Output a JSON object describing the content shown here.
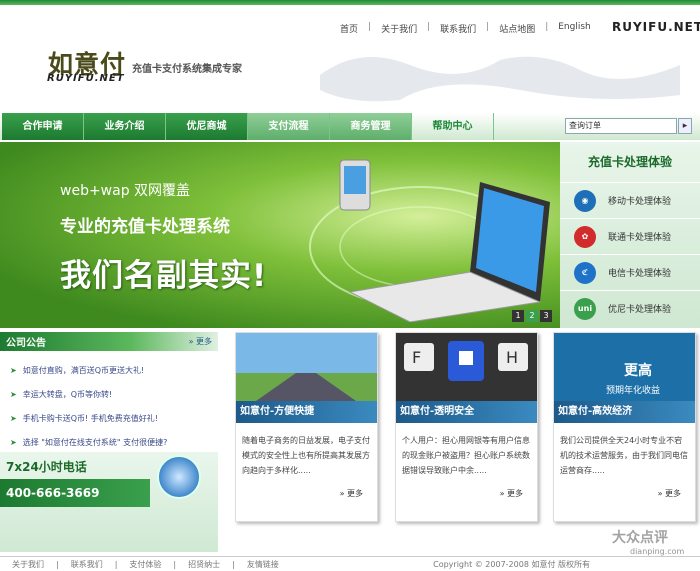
{
  "header": {
    "logo_cn": "如意付",
    "logo_en": "RUYIFU.NET",
    "slogan": "充值卡支付系统集成专家",
    "top_links": [
      "首页",
      "关于我们",
      "联系我们",
      "站点地图",
      "English"
    ],
    "brand_right": "RUYIFU.NET"
  },
  "nav": {
    "items": [
      "合作申请",
      "业务介绍",
      "优尼商城",
      "支付流程",
      "商务管理",
      "帮助中心"
    ],
    "search_placeholder": "查询订单"
  },
  "banner": {
    "line1": "web+wap  双网覆盖",
    "line2": "专业的充值卡处理系统",
    "line3": "我们名副其实!",
    "pages": [
      "1",
      "2",
      "3"
    ],
    "active_page": 2
  },
  "side": {
    "title": "充值卡处理体验",
    "items": [
      {
        "label": "移动卡处理体验",
        "icon": "china-mobile-icon",
        "color": "#1e6fb8"
      },
      {
        "label": "联通卡处理体验",
        "icon": "china-unicom-icon",
        "color": "#d12b2b"
      },
      {
        "label": "电信卡处理体验",
        "icon": "china-telecom-icon",
        "color": "#1e73c8"
      },
      {
        "label": "优尼卡处理体验",
        "icon": "uni-card-icon",
        "color": "#3aa04d"
      }
    ]
  },
  "notice": {
    "title": "公司公告",
    "more": "更多",
    "items": [
      "如意付直购，满百送Q币更送大礼!",
      "幸运大转盘，Q币等你转!",
      "手机卡购卡送Q币! 手机免费充值好礼!",
      "选择 \"如意付在线支付系统\" 支付很便捷?"
    ]
  },
  "hotline": {
    "label": "7x24小时电话",
    "phone": "400-666-3669"
  },
  "cards": [
    {
      "title": "如意付-方便快捷",
      "text": "随着电子商务的日益发展，电子支付模式的安全性上也有所提高其发展方向趋向于多样化.....",
      "more": "更多"
    },
    {
      "title": "如意付-透明安全",
      "text": "个人用户：担心用网银等有用户信息的现金账户被盗用？担心账户系统数据错误导致账户中余.....",
      "more": "更多"
    },
    {
      "title": "如意付-高效经济",
      "text": "我们公司提供全天24小时专业不宕机的技术运营服务，由于我们同电信运营商存.....",
      "more": "更多"
    }
  ],
  "card_image_text": {
    "keys": [
      "F",
      "H"
    ],
    "promo1": "更高",
    "promo2": "预期年化收益"
  },
  "footer": {
    "links": [
      "关于我们",
      "联系我们",
      "支付体验",
      "招贤纳士",
      "友情链接"
    ],
    "copyright": "Copyright © 2007-2008 如意付 版权所有"
  },
  "watermark": {
    "cn": "大众点评",
    "en": "dianping.com"
  }
}
